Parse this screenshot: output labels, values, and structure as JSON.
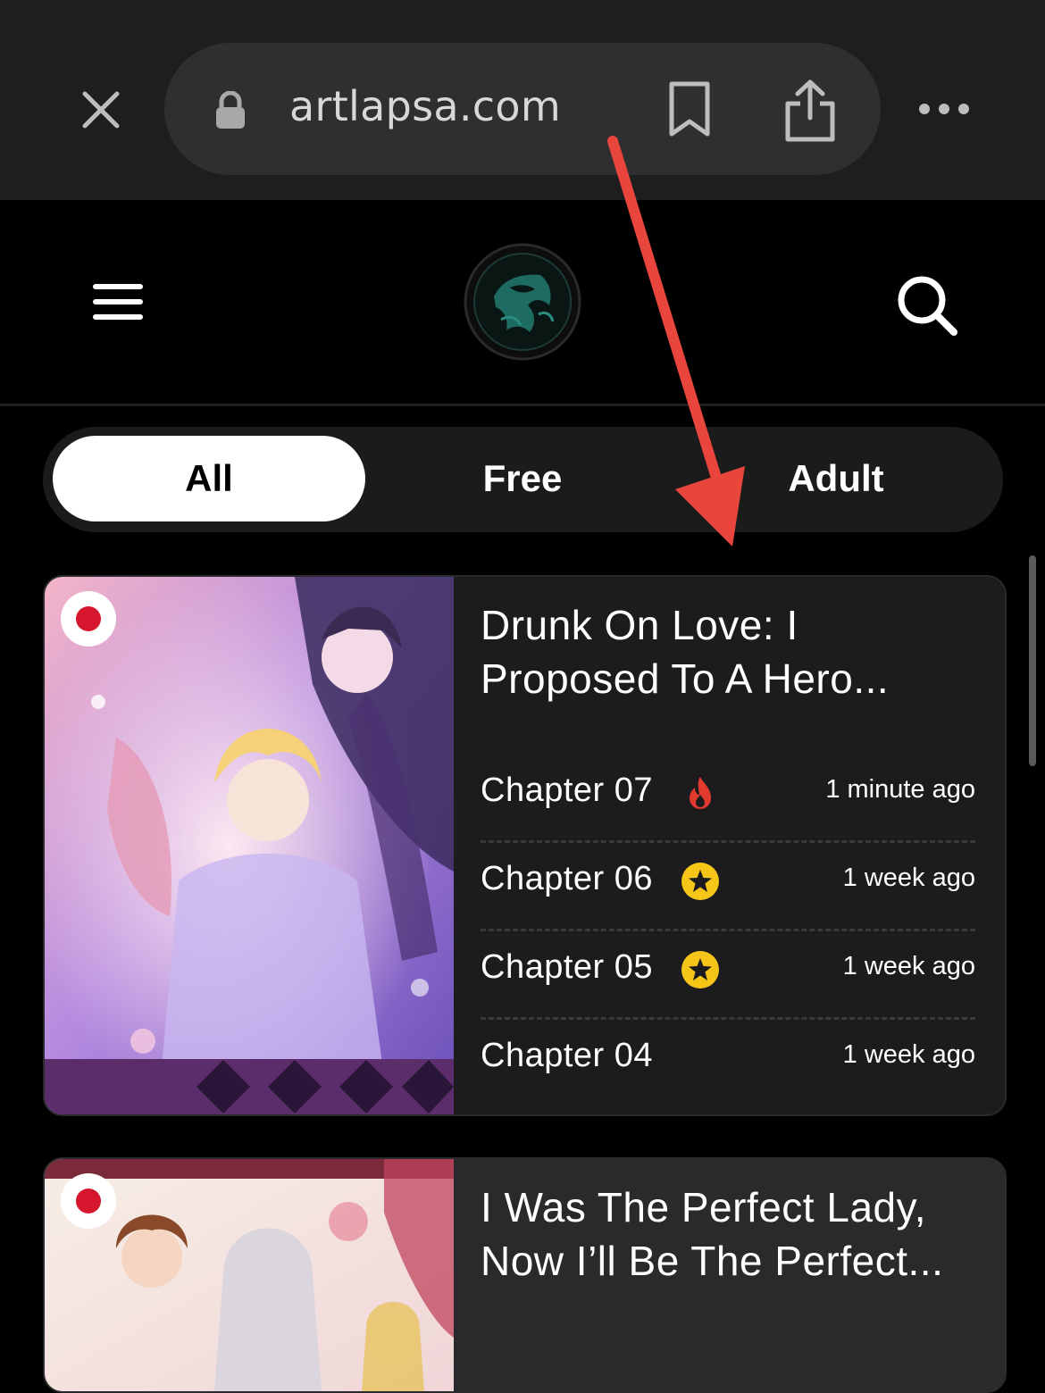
{
  "browser": {
    "url": "artlapsa.com"
  },
  "filters": {
    "tabs": [
      "All",
      "Free",
      "Adult"
    ],
    "active": "All"
  },
  "cards": [
    {
      "title_line1": "Drunk On Love: I",
      "title_line2": "Proposed To A Hero...",
      "chapters": [
        {
          "label": "Chapter 07",
          "time": "1 minute ago",
          "badge": "fire-icon"
        },
        {
          "label": "Chapter 06",
          "time": "1 week ago",
          "badge": "star-icon"
        },
        {
          "label": "Chapter 05",
          "time": "1 week ago",
          "badge": "star-icon"
        },
        {
          "label": "Chapter 04",
          "time": "1 week ago",
          "badge": ""
        }
      ]
    },
    {
      "title_line1": "I Was The Perfect Lady,",
      "title_line2": "Now I’ll Be The Perfect..."
    }
  ],
  "colors": {
    "accent_arrow": "#e8453c",
    "fire": "#e23b2e",
    "star": "#f5c518"
  }
}
